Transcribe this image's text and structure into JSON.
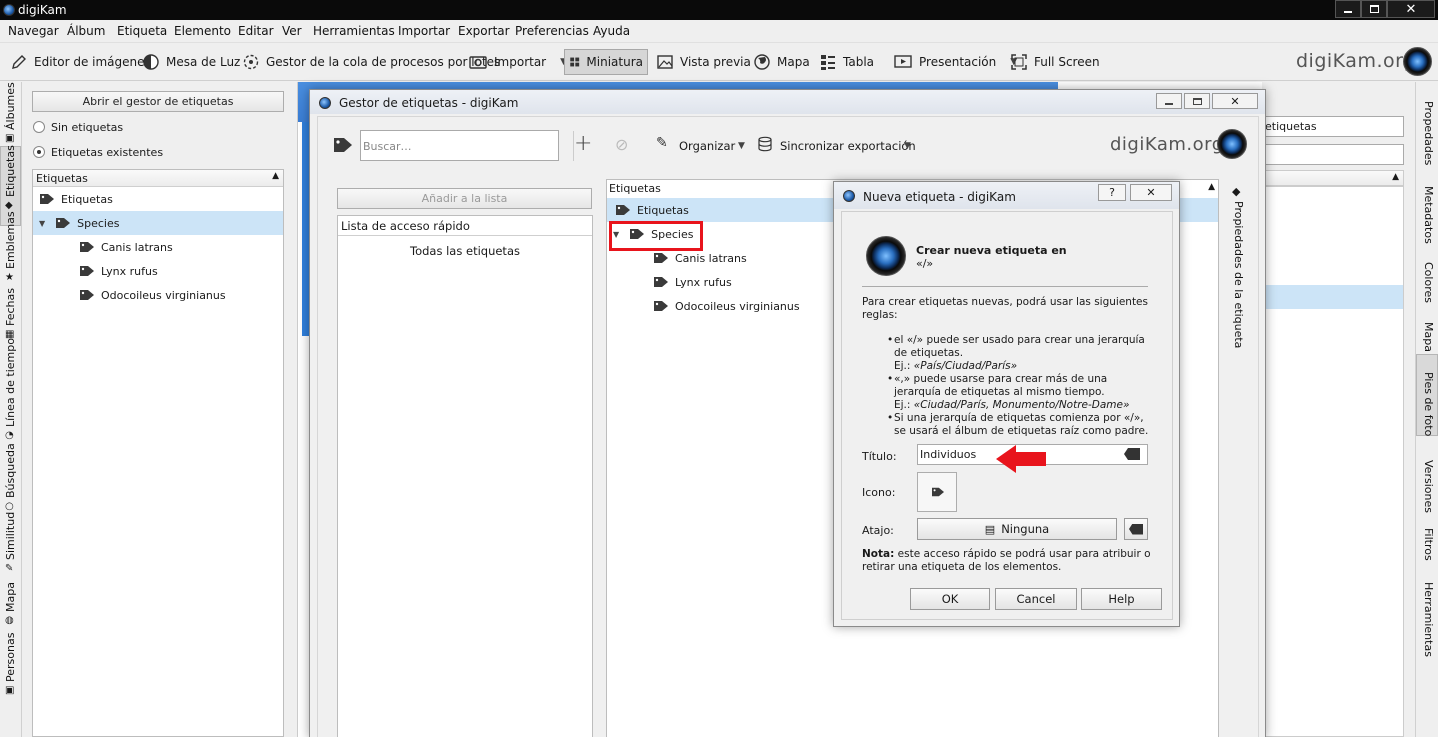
{
  "app": {
    "title": "digiKam"
  },
  "menu": [
    "Navegar",
    "Álbum",
    "Etiqueta",
    "Elemento",
    "Editar",
    "Ver",
    "Herramientas",
    "Importar",
    "Exportar",
    "Preferencias",
    "Ayuda"
  ],
  "toolbar": {
    "image_editor": "Editor de imágenes",
    "light_table": "Mesa de Luz",
    "batch_queue": "Gestor de la cola de procesos por lotes",
    "import": "Importar",
    "thumbnails": "Miniatura",
    "preview": "Vista previa",
    "map": "Mapa",
    "table": "Tabla",
    "presentation": "Presentación",
    "fullscreen": "Full Screen",
    "logo": "digiKam.org"
  },
  "left_tabs": [
    "Álbumes",
    "Etiquetas",
    "Emblemas",
    "Fechas",
    "Línea de tiempo",
    "Búsqueda",
    "Similitud",
    "Mapa",
    "Personas"
  ],
  "left_panel": {
    "open_manager": "Abrir el gestor de etiquetas",
    "no_tags": "Sin etiquetas",
    "existing_tags": "Etiquetas existentes",
    "header": "Etiquetas",
    "root": "Etiquetas",
    "species": "Species",
    "items": [
      "Canis latrans",
      "Lynx rufus",
      "Odocoileus virginianus"
    ]
  },
  "right_tabs": [
    "Propedades",
    "Metadatos",
    "Colores",
    "Mapa",
    "Pies de foto",
    "Versiones",
    "Filtros",
    "Herramientas"
  ],
  "bg_right": {
    "field1": "etiquetas"
  },
  "tag_manager": {
    "title": "Gestor de etiquetas - digiKam",
    "search_placeholder": "Buscar…",
    "organize": "Organizar",
    "sync_export": "Sincronizar exportación",
    "logo": "digiKam.org",
    "add_to_list": "Añadir a la lista",
    "quick_list_header": "Lista de acceso rápido",
    "all_tags": "Todas las etiquetas",
    "tree_header": "Etiquetas",
    "tree_root": "Etiquetas",
    "tree_species": "Species",
    "tree_items": [
      "Canis latrans",
      "Lynx rufus",
      "Odocoileus virginianus"
    ],
    "side_tab": "Propiedades de la etiqueta"
  },
  "new_tag": {
    "title": "Nueva etiqueta - digiKam",
    "help_btn": "?",
    "heading": "Crear nueva etiqueta en",
    "heading_path": "«/»",
    "intro": "Para crear etiquetas nuevas, podrá usar las siguientes reglas:",
    "rule1": "el «/» puede ser usado para crear una jerarquía de etiquetas.",
    "rule1_ex_label": "Ej.:",
    "rule1_ex": "«País/Ciudad/París»",
    "rule2": "«,» puede usarse para crear más de una jerarquía de etiquetas al mismo tiempo.",
    "rule2_ex_label": "Ej.:",
    "rule2_ex": "«Ciudad/París, Monumento/Notre-Dame»",
    "rule3": "Si una jerarquía de etiquetas comienza por «/», se usará el álbum de etiquetas raíz como padre.",
    "title_label": "Título:",
    "title_value": "Individuos",
    "icon_label": "Icono:",
    "shortcut_label": "Atajo:",
    "shortcut_value": "Ninguna",
    "note_bold": "Nota:",
    "note": "este acceso rápido se podrá usar para atribuir o retirar una etiqueta de los elementos.",
    "ok": "OK",
    "cancel": "Cancel",
    "help": "Help"
  },
  "colors": {
    "highlight": "#cce4f7",
    "annotation_red": "#e8141c",
    "bg_blue": "#2f7fdc"
  }
}
